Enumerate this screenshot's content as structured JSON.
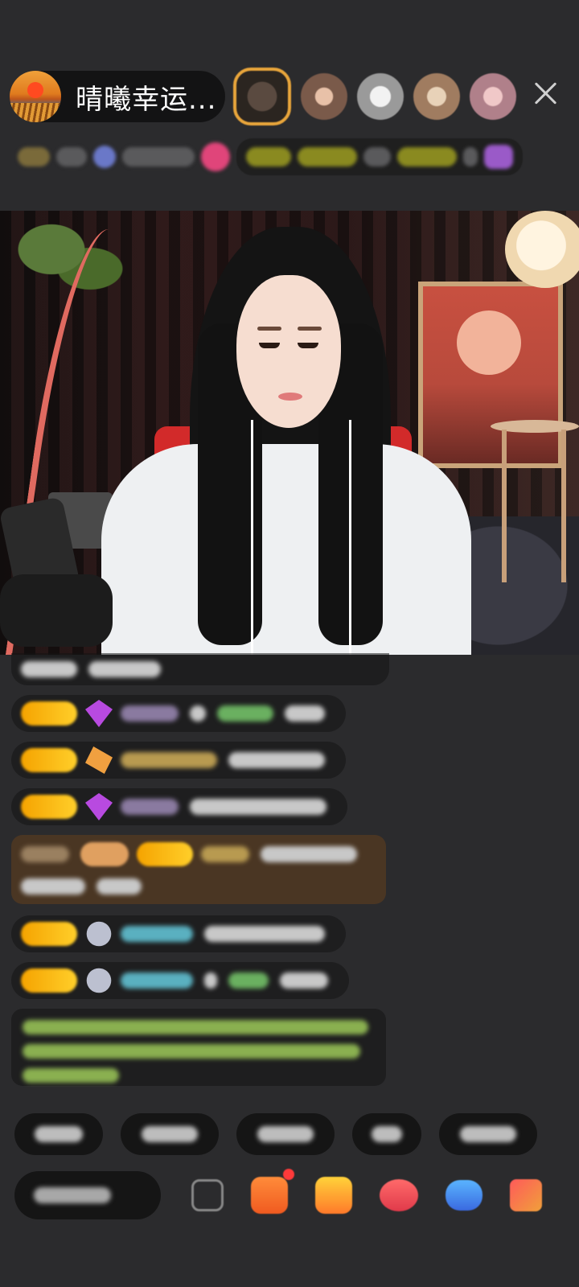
{
  "header": {
    "host_name": "晴曦幸运..."
  },
  "icons": {
    "close": "close-icon",
    "emoji": "emoji-icon",
    "gift": "gift-icon",
    "bag": "bag-icon",
    "heart": "heart-icon",
    "game": "game-icon",
    "more": "grid-icon"
  },
  "colors": {
    "background": "#2b2b2d",
    "badge": "#f5a300",
    "chair": "#d22a2a",
    "notice_text": "#8ab050"
  }
}
